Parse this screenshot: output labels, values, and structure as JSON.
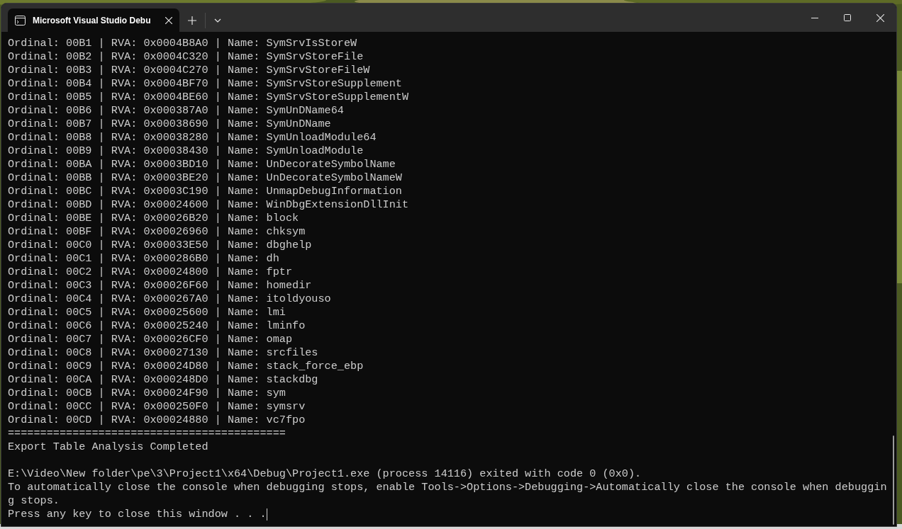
{
  "window": {
    "tab": {
      "title": "Microsoft Visual Studio Debu",
      "selected": true
    }
  },
  "console": {
    "lines": [
      "Ordinal: 00B1 | RVA: 0x0004B8A0 | Name: SymSrvIsStoreW",
      "Ordinal: 00B2 | RVA: 0x0004C320 | Name: SymSrvStoreFile",
      "Ordinal: 00B3 | RVA: 0x0004C270 | Name: SymSrvStoreFileW",
      "Ordinal: 00B4 | RVA: 0x0004BF70 | Name: SymSrvStoreSupplement",
      "Ordinal: 00B5 | RVA: 0x0004BE60 | Name: SymSrvStoreSupplementW",
      "Ordinal: 00B6 | RVA: 0x000387A0 | Name: SymUnDName64",
      "Ordinal: 00B7 | RVA: 0x00038690 | Name: SymUnDName",
      "Ordinal: 00B8 | RVA: 0x00038280 | Name: SymUnloadModule64",
      "Ordinal: 00B9 | RVA: 0x00038430 | Name: SymUnloadModule",
      "Ordinal: 00BA | RVA: 0x0003BD10 | Name: UnDecorateSymbolName",
      "Ordinal: 00BB | RVA: 0x0003BE20 | Name: UnDecorateSymbolNameW",
      "Ordinal: 00BC | RVA: 0x0003C190 | Name: UnmapDebugInformation",
      "Ordinal: 00BD | RVA: 0x00024600 | Name: WinDbgExtensionDllInit",
      "Ordinal: 00BE | RVA: 0x00026B20 | Name: block",
      "Ordinal: 00BF | RVA: 0x00026960 | Name: chksym",
      "Ordinal: 00C0 | RVA: 0x00033E50 | Name: dbghelp",
      "Ordinal: 00C1 | RVA: 0x000286B0 | Name: dh",
      "Ordinal: 00C2 | RVA: 0x00024800 | Name: fptr",
      "Ordinal: 00C3 | RVA: 0x00026F60 | Name: homedir",
      "Ordinal: 00C4 | RVA: 0x000267A0 | Name: itoldyouso",
      "Ordinal: 00C5 | RVA: 0x00025600 | Name: lmi",
      "Ordinal: 00C6 | RVA: 0x00025240 | Name: lminfo",
      "Ordinal: 00C7 | RVA: 0x00026CF0 | Name: omap",
      "Ordinal: 00C8 | RVA: 0x00027130 | Name: srcfiles",
      "Ordinal: 00C9 | RVA: 0x00024D80 | Name: stack_force_ebp",
      "Ordinal: 00CA | RVA: 0x000248D0 | Name: stackdbg",
      "Ordinal: 00CB | RVA: 0x00024F90 | Name: sym",
      "Ordinal: 00CC | RVA: 0x000250F0 | Name: symsrv",
      "Ordinal: 00CD | RVA: 0x00024880 | Name: vc7fpo",
      "===========================================",
      "Export Table Analysis Completed"
    ],
    "exit_messages": [
      "E:\\Video\\New folder\\pe\\3\\Project1\\x64\\Debug\\Project1.exe (process 14116) exited with code 0 (0x0).",
      "To automatically close the console when debugging stops, enable Tools->Options->Debugging->Automatically close the console when debugging stops.",
      "Press any key to close this window . . ."
    ]
  }
}
